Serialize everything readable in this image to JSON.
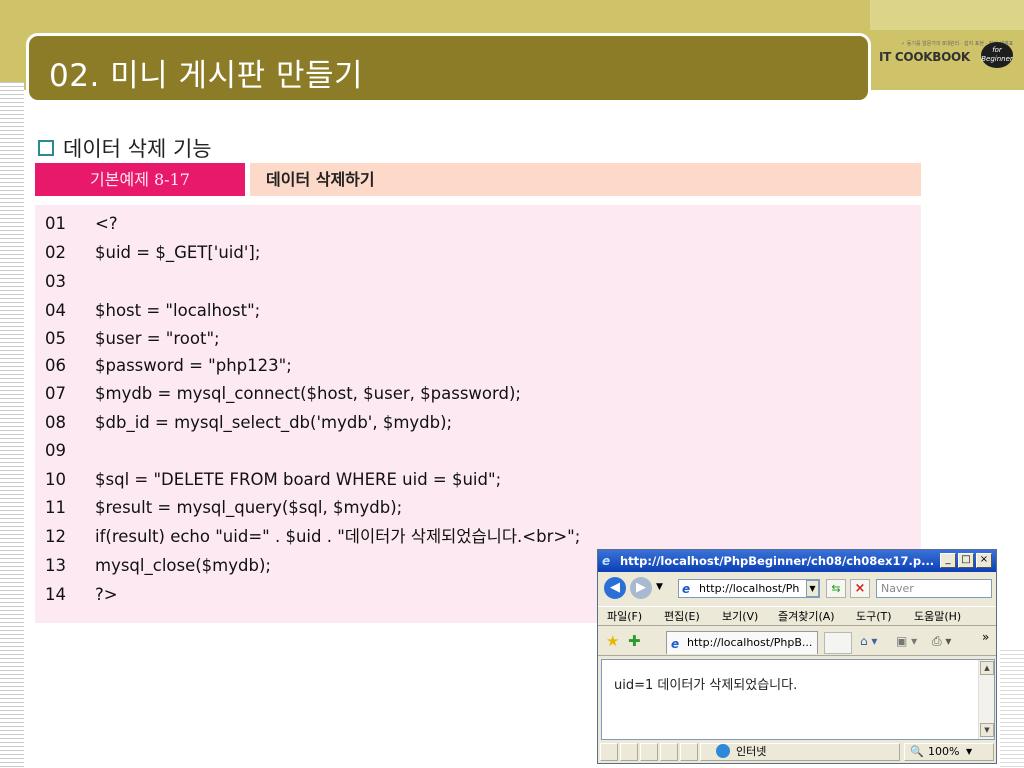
{
  "slide": {
    "title": "02. 미니 게시판 만들기",
    "logo": {
      "small_text": "✓ 동기를 알문가의 8대원리 · 쉽지 표현 · 자신 세계표",
      "brand": "IT COOKBOOK",
      "badge_top": "for",
      "badge_bottom": "Beginner"
    },
    "section_heading": "데이터 삭제 기능",
    "example_tag": "기본예제 8-17",
    "example_title": "데이터 삭제하기"
  },
  "code": {
    "lines": [
      {
        "no": "01",
        "text": "<?"
      },
      {
        "no": "02",
        "text": "$uid = $_GET['uid'];"
      },
      {
        "no": "03",
        "text": ""
      },
      {
        "no": "04",
        "text": "$host = \"localhost\";"
      },
      {
        "no": "05",
        "text": "$user = \"root\";"
      },
      {
        "no": "06",
        "text": "$password = \"php123\";"
      },
      {
        "no": "07",
        "text": "$mydb = mysql_connect($host, $user, $password);"
      },
      {
        "no": "08",
        "text": "$db_id = mysql_select_db('mydb', $mydb);"
      },
      {
        "no": "09",
        "text": ""
      },
      {
        "no": "10",
        "text": "$sql = \"DELETE FROM board WHERE uid = $uid\";"
      },
      {
        "no": "11",
        "text": "$result = mysql_query($sql, $mydb);"
      },
      {
        "no": "12",
        "text": "if(result) echo \"uid=\" . $uid . \"데이터가 삭제되었습니다.<br>\";"
      },
      {
        "no": "13",
        "text": "mysql_close($mydb);"
      },
      {
        "no": "14",
        "text": "?>"
      }
    ]
  },
  "browser": {
    "window_title": "http://localhost/PhpBeginner/ch08/ch08ex17.p...",
    "window_buttons": {
      "minimize": "_",
      "maximize": "□",
      "close": "×"
    },
    "address": "http://localhost/Ph",
    "search_placeholder": "Naver",
    "menu": [
      "파일(F)",
      "편집(E)",
      "보기(V)",
      "즐겨찾기(A)",
      "도구(T)",
      "도움말(H)"
    ],
    "tab_label": "http://localhost/PhpB...",
    "content_text": "uid=1 데이터가 삭제되었습니다.",
    "status_zone": "인터넷",
    "zoom": "100%",
    "icons": {
      "back": "back-arrow-icon",
      "forward": "forward-arrow-icon",
      "favorites": "star-icon",
      "add_favorite": "add-favorite-icon",
      "home": "home-icon",
      "feeds": "feed-icon",
      "print": "print-icon"
    }
  }
}
